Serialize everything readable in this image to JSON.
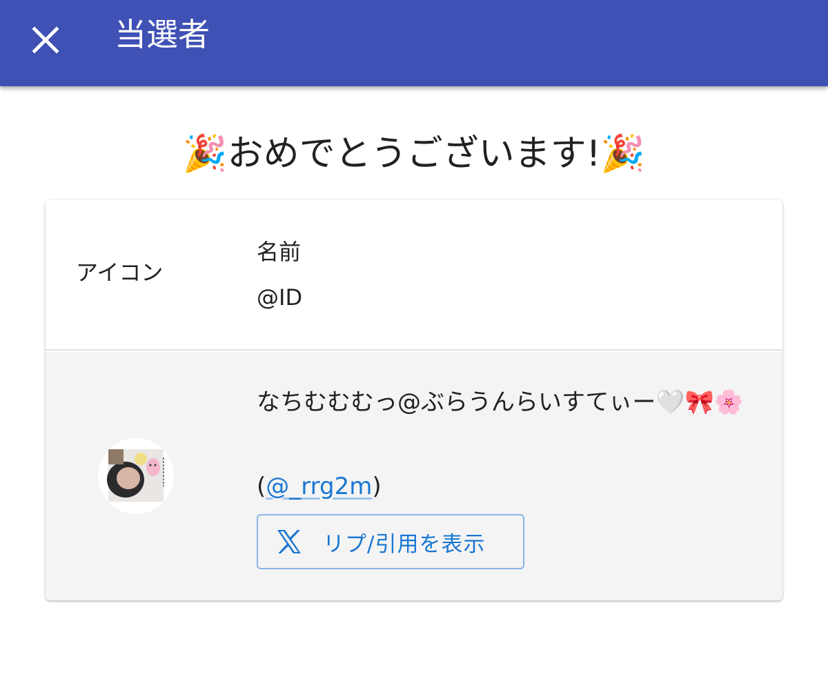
{
  "appbar": {
    "title": "当選者",
    "close_icon": "close-icon"
  },
  "congrats": {
    "text": "🎉おめでとうございます!🎉"
  },
  "table": {
    "headers": {
      "icon": "アイコン",
      "name": "名前",
      "id": "@ID"
    },
    "rows": [
      {
        "name": "なちむむむっ@ぶらうんらいすてぃー🤍🎀🌸",
        "handle_prefix": "(",
        "handle": "@_rrg2m",
        "handle_suffix": ")",
        "reply_button_label": "リプ/引用を表示",
        "reply_button_icon": "x-logo-icon"
      }
    ]
  },
  "colors": {
    "appbar": "#3f51b5",
    "link": "#1976d2",
    "row_bg": "#f4f4f4"
  }
}
